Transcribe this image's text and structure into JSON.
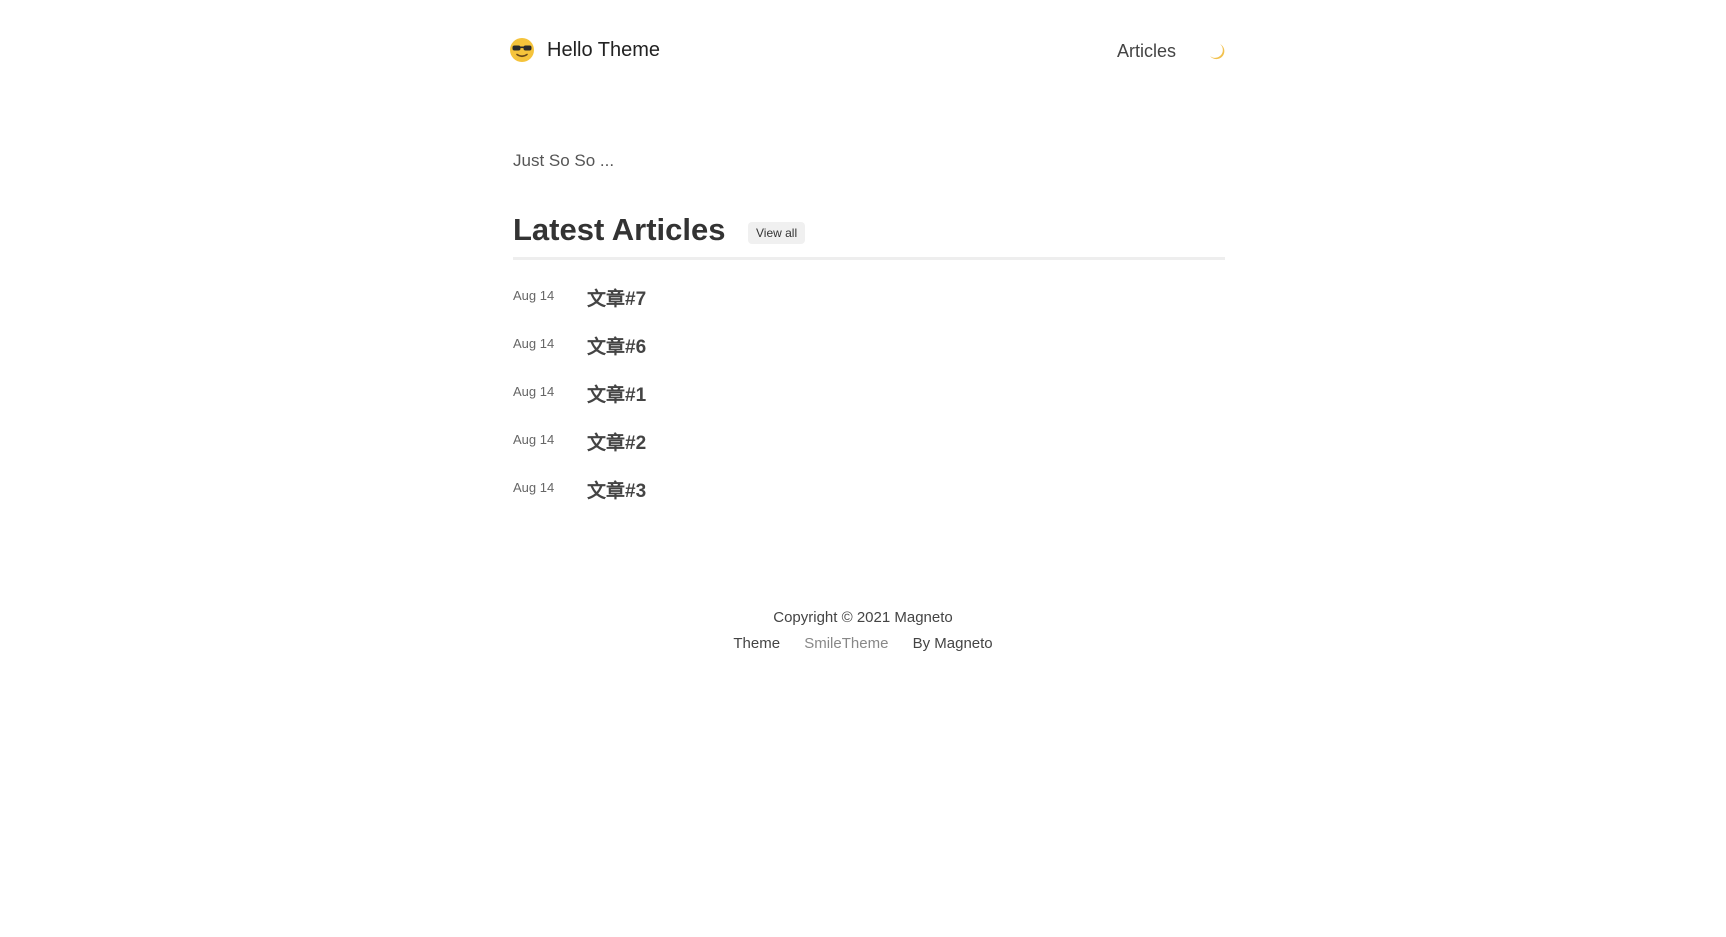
{
  "header": {
    "brand_title": "Hello Theme",
    "brand_icon": "sunglasses-face-icon",
    "nav_articles": "Articles",
    "theme_toggle_icon": "crescent-moon-icon"
  },
  "intro": {
    "text": "Just So So ..."
  },
  "latest": {
    "heading": "Latest Articles",
    "view_all": "View all"
  },
  "articles": [
    {
      "date": "Aug 14",
      "title": "文章#7"
    },
    {
      "date": "Aug 14",
      "title": "文章#6"
    },
    {
      "date": "Aug 14",
      "title": "文章#1"
    },
    {
      "date": "Aug 14",
      "title": "文章#2"
    },
    {
      "date": "Aug 14",
      "title": "文章#3"
    }
  ],
  "footer": {
    "copyright": "Copyright © 2021 Magneto",
    "theme_prefix": "Theme",
    "theme_name": "SmileTheme",
    "by_author": "By Magneto"
  },
  "colors": {
    "text_dark": "#333333",
    "muted": "#888888",
    "divider": "#eeeeee",
    "emoji_yellow": "#f5c33b",
    "moon_yellow": "#f2c14e"
  }
}
